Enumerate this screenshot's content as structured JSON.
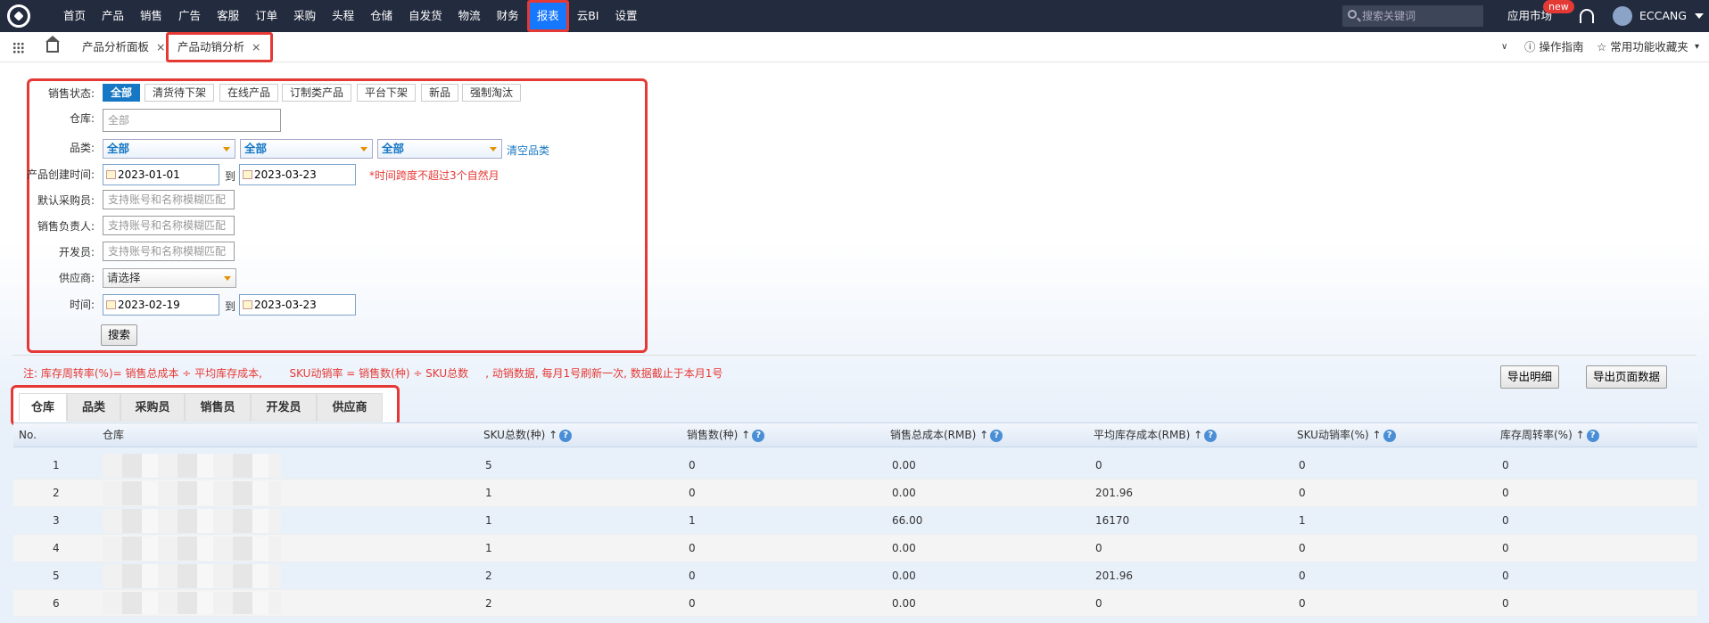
{
  "topnav": {
    "items": [
      "首页",
      "产品",
      "销售",
      "广告",
      "客服",
      "订单",
      "采购",
      "头程",
      "仓储",
      "自发货",
      "物流",
      "财务",
      "报表",
      "云BI",
      "设置"
    ],
    "active_index": 12,
    "search_placeholder": "搜索关键词",
    "app_market": "应用市场",
    "new_badge": "new",
    "username": "ECCANG"
  },
  "tabbar": {
    "tabs": [
      {
        "label": "产品分析面板",
        "close": "×"
      },
      {
        "label": "产品动销分析",
        "close": "×"
      }
    ],
    "active_index": 1,
    "guide": "操作指南",
    "favorites": "常用功能收藏夹"
  },
  "filters": {
    "sales_status_label": "销售状态:",
    "sales_status_options": [
      "全部",
      "清货待下架",
      "在线产品",
      "订制类产品",
      "平台下架",
      "新品",
      "强制淘汰"
    ],
    "sales_status_selected": 0,
    "warehouse_label": "仓库:",
    "warehouse_placeholder": "全部",
    "category_label": "品类:",
    "category_values": [
      "全部",
      "全部",
      "全部"
    ],
    "clear_category": "清空品类",
    "created_time_label": "产品创建时间:",
    "created_from": "2023-01-01",
    "to": "到",
    "created_to": "2023-03-23",
    "created_hint": "*时间跨度不超过3个自然月",
    "buyer_label": "默认采购员:",
    "seller_label": "销售负责人:",
    "developer_label": "开发员:",
    "fuzzy_placeholder": "支持账号和名称模糊匹配",
    "supplier_label": "供应商:",
    "supplier_value": "请选择",
    "time_label": "时间:",
    "time_from": "2023-02-19",
    "time_to": "2023-03-23",
    "search_button": "搜索"
  },
  "note": "注: 库存周转率(%)= 销售总成本 ÷ 平均库存成本,        SKU动销率 = 销售数(种) ÷ SKU总数     , 动销数据, 每月1号刷新一次, 数据截止于本月1号",
  "export_detail": "导出明细",
  "export_page": "导出页面数据",
  "dimension_tabs": [
    "仓库",
    "品类",
    "采购员",
    "销售员",
    "开发员",
    "供应商"
  ],
  "dimension_selected": 0,
  "table": {
    "headers": [
      "No.",
      "仓库",
      "SKU总数(种) ↑",
      "销售数(种) ↑",
      "销售总成本(RMB) ↑",
      "平均库存成本(RMB) ↑",
      "SKU动销率(%) ↑",
      "库存周转率(%) ↑"
    ],
    "help_icon": "?",
    "rows": [
      [
        "1",
        "",
        "5",
        "0",
        "0.00",
        "0",
        "0",
        "0"
      ],
      [
        "2",
        "",
        "1",
        "0",
        "0.00",
        "201.96",
        "0",
        "0"
      ],
      [
        "3",
        "",
        "1",
        "1",
        "66.00",
        "16170",
        "1",
        "0"
      ],
      [
        "4",
        "",
        "1",
        "0",
        "0.00",
        "0",
        "0",
        "0"
      ],
      [
        "5",
        "",
        "2",
        "0",
        "0.00",
        "201.96",
        "0",
        "0"
      ],
      [
        "6",
        "",
        "2",
        "0",
        "0.00",
        "0",
        "0",
        "0"
      ]
    ]
  }
}
